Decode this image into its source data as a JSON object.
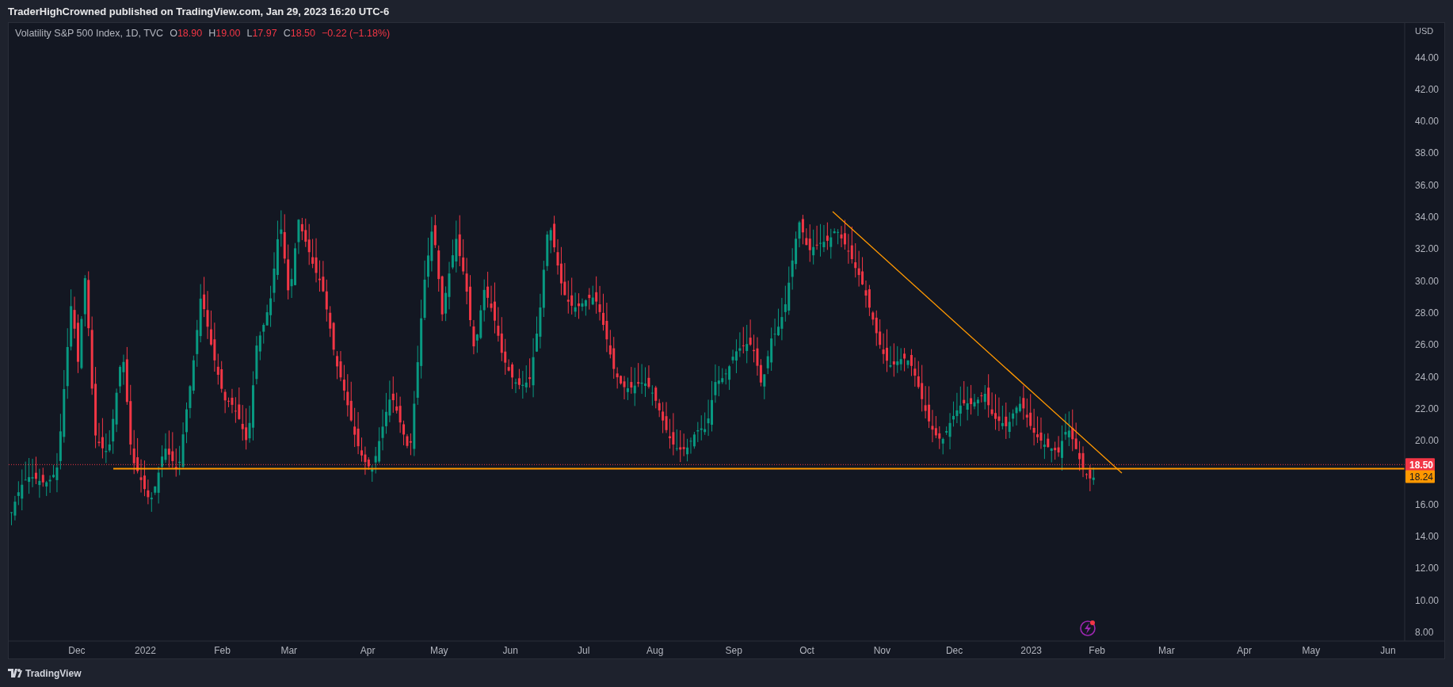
{
  "header": {
    "text": "TraderHighCrowned published on TradingView.com, Jan 29, 2023 16:20 UTC-6"
  },
  "legend": {
    "symbol": "Volatility S&P 500 Index, 1D, TVC",
    "negative": true,
    "values": [
      {
        "label": "O",
        "value": "18.90"
      },
      {
        "label": "H",
        "value": "19.00"
      },
      {
        "label": "L",
        "value": "17.97"
      },
      {
        "label": "C",
        "value": "18.50"
      }
    ],
    "change": "−0.22 (−1.18%)"
  },
  "price_axis": {
    "unit": "USD",
    "ticks": [
      "44.00",
      "42.00",
      "40.00",
      "38.00",
      "36.00",
      "34.00",
      "32.00",
      "30.00",
      "28.00",
      "26.00",
      "24.00",
      "22.00",
      "20.00",
      "16.00",
      "14.00",
      "12.00",
      "10.00",
      "8.00"
    ]
  },
  "price_tags": [
    {
      "text": "18.50",
      "kind": "last",
      "color": "#f23645"
    },
    {
      "text": "18.24",
      "kind": "line",
      "color": "#ff9800"
    }
  ],
  "time_axis": {
    "labels": [
      "Dec",
      "2022",
      "Feb",
      "Mar",
      "Apr",
      "May",
      "Jun",
      "Jul",
      "Aug",
      "Sep",
      "Oct",
      "Nov",
      "Dec",
      "2023",
      "Feb",
      "Mar",
      "Apr",
      "May",
      "Jun"
    ]
  },
  "footer": {
    "brand": "TradingView"
  }
}
